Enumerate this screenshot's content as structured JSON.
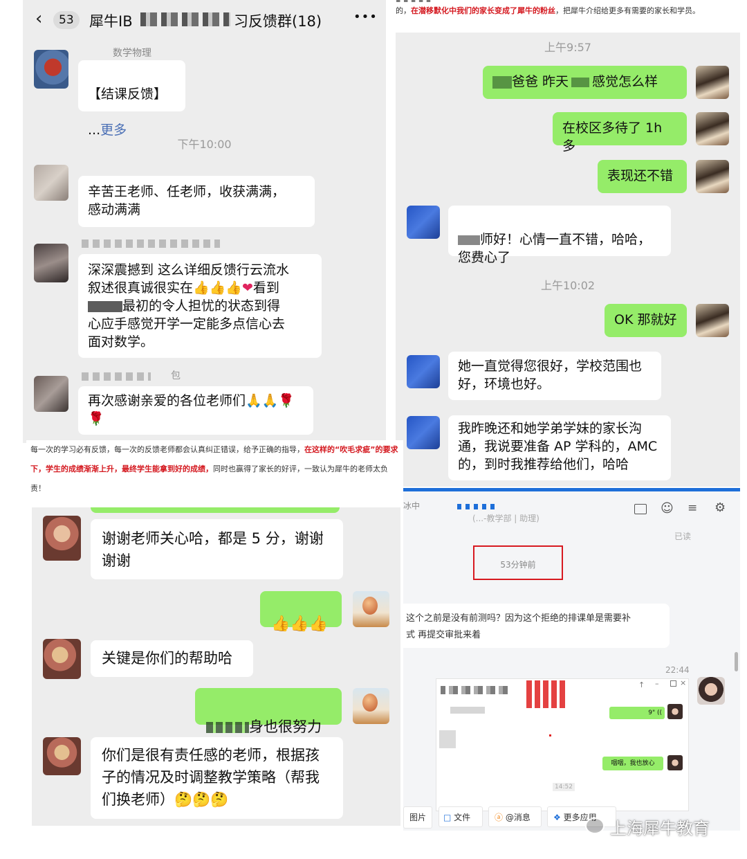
{
  "p1": {
    "badge": "53",
    "title_prefix": "犀牛IB",
    "title_suffix": "习反馈群(18)",
    "more": "•••",
    "sender1": "数学物理",
    "msg1_line1": "【结课反馈】",
    "msg1_line2": "...",
    "msg1_more": "更多",
    "time1": "下午10:00",
    "msg2": "辛苦王老师、任老师，收获满满，\n感动满满",
    "msg3_l1": "深深震撼到 这么详细反馈行云流水",
    "msg3_l2": "叙述很真诚很实在",
    "msg3_l2b": "看到",
    "msg3_l3": "最初的令人担忧的状态到得",
    "msg3_l4": "心应手感觉开学一定能多点信心去",
    "msg3_l5": "面对数学。",
    "sender4": "包",
    "msg4": "再次感谢亲爱的各位老师们",
    "sender3": "包"
  },
  "p2": {
    "top_text": "的，",
    "top_red": "在潜移默化中我们的家长变成了犀牛的粉丝",
    "top_text2": "，把犀牛介绍给更多有需要的家长和学员。",
    "time1": "上午9:57",
    "msg1a": "爸爸 昨天",
    "msg1b": "感觉怎么样",
    "msg2": "在校区多待了 1h 多",
    "msg3": "表现还不错",
    "msg4": "师好！心情一直不错，哈哈，\n您费心了",
    "time2": "上午10:02",
    "msg5": "OK 那就好",
    "msg6": "她一直觉得您很好，学校范围也\n好，环境也好。",
    "msg7": "我昨晚还和她学弟学妹的家长沟\n通，我说要准备 AP 学科的，AMC\n的，到时我推荐给他们，哈哈"
  },
  "p3": {
    "caption_a": "每一次的学习必有反馈，每一次的反馈老师都会认真纠正错误，给予正确的指导，",
    "caption_red1": "在这样的“吹毛求疵”",
    "caption_red2": "的要求下，学生的成绩渐渐上升，最终学生能拿到好的成绩，",
    "caption_b": "同时也赢得了家长的好评，一致认为犀牛的老师太负责！",
    "msg1": "谢谢老师关心哈，都是 5 分，谢谢\n谢谢",
    "msg2": "关键是你们的帮助哈",
    "msg3": "身也很努力",
    "msg4": "你们是很有责任感的老师，根据孩\n子的情况及时调整教学策略（帮我\n们换老师）"
  },
  "p4": {
    "name_prefix": "冰中",
    "role": "(...-教学部 | 助理)",
    "read": "已读",
    "time_ago": "53分钟前",
    "msg1_l1": "这个之前是没有前测吗？因为这个拒绝的排课单是需要补",
    "msg1_l2": "式 再提交审批来着",
    "time2": "22:44",
    "inner_voice": "9\" ((",
    "inner_text": "咽咽，我也放心",
    "inner_ts": "14:52",
    "tool_image": "图片",
    "tool_file": "文件",
    "tool_mention": "@消息",
    "tool_more": "更多应用"
  },
  "watermark": "上海犀牛教育",
  "colors": {
    "green": "#95ec69",
    "red": "#d4181f",
    "panel": "#ededed",
    "blue": "#1e6fd9"
  }
}
